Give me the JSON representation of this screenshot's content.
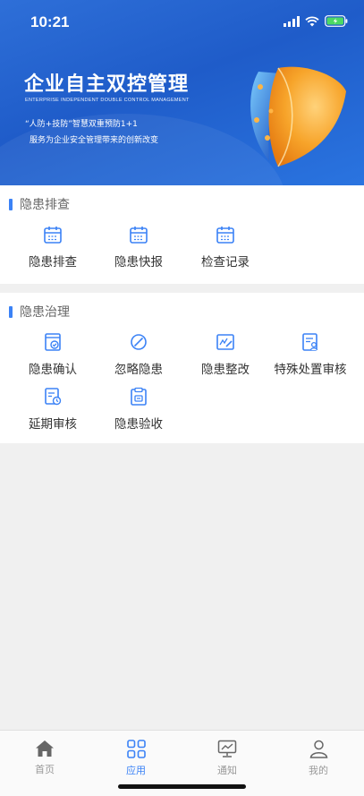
{
  "status": {
    "time": "10:21"
  },
  "banner": {
    "title": "企业自主双控管理",
    "subtitle": "ENTERPRISE INDEPENDENT DOUBLE CONTROL MANAGEMENT",
    "line1": "“人防+技防”智慧双重预防1+1",
    "line2": "服务为企业安全管理带来的创新改变"
  },
  "sections": [
    {
      "title": "隐患排查",
      "items": [
        {
          "label": "隐患排查",
          "icon": "calendar-icon"
        },
        {
          "label": "隐患快报",
          "icon": "calendar-icon"
        },
        {
          "label": "检查记录",
          "icon": "calendar-icon"
        }
      ]
    },
    {
      "title": "隐患治理",
      "items": [
        {
          "label": "隐患确认",
          "icon": "confirm-check-icon"
        },
        {
          "label": "忽略隐患",
          "icon": "ban-icon"
        },
        {
          "label": "隐患整改",
          "icon": "edit-document-icon"
        },
        {
          "label": "特殊处置审核",
          "icon": "review-person-icon"
        },
        {
          "label": "延期审核",
          "icon": "clock-document-icon"
        },
        {
          "label": "隐患验收",
          "icon": "acceptance-icon"
        }
      ]
    }
  ],
  "tabbar": {
    "active": "应用",
    "items": [
      {
        "label": "首页",
        "icon": "home-icon"
      },
      {
        "label": "应用",
        "icon": "apps-grid-icon"
      },
      {
        "label": "通知",
        "icon": "monitor-chart-icon"
      },
      {
        "label": "我的",
        "icon": "user-icon"
      }
    ]
  },
  "colors": {
    "accent": "#3b82f6",
    "banner": "#2563d6",
    "icon": "#3b82f6"
  }
}
